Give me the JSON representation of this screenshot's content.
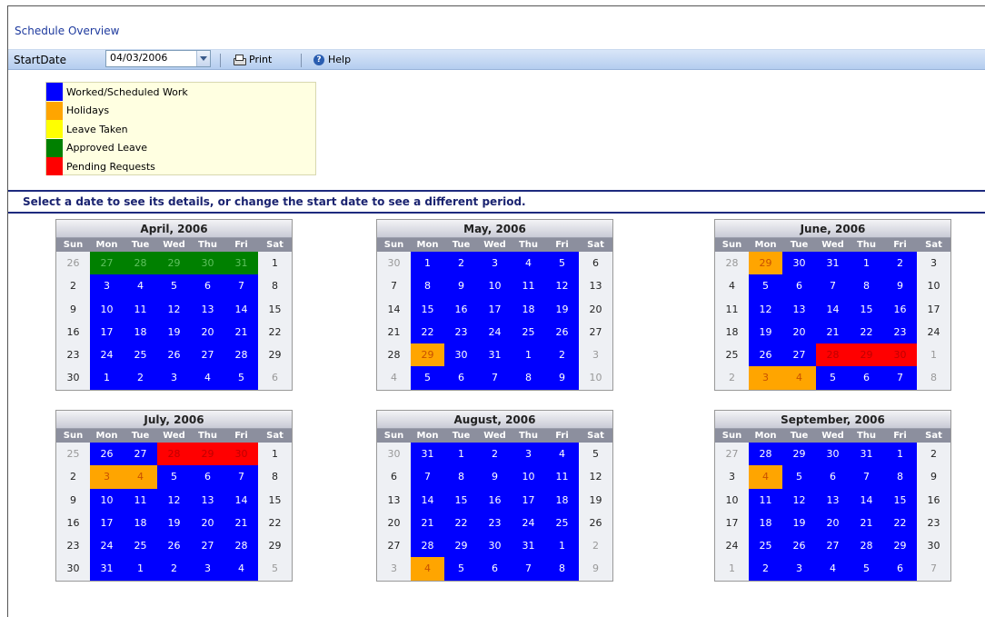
{
  "page_title": "Schedule Overview",
  "toolbar": {
    "start_date_label": "StartDate",
    "start_date_value": "04/03/2006",
    "print_label": "Print",
    "help_label": "Help"
  },
  "legend": [
    {
      "label": "Worked/Scheduled Work",
      "color": "#0000ff"
    },
    {
      "label": "Holidays",
      "color": "#ffa500"
    },
    {
      "label": "Leave Taken",
      "color": "#ffff00"
    },
    {
      "label": "Approved Leave",
      "color": "#008000"
    },
    {
      "label": "Pending Requests",
      "color": "#ff0000"
    }
  ],
  "instruction": "Select a date to see its details, or change the start date to see a different period.",
  "weekdays": [
    "Sun",
    "Mon",
    "Tue",
    "Wed",
    "Thu",
    "Fri",
    "Sat"
  ],
  "months": [
    {
      "title": "April, 2006",
      "weeks": [
        [
          [
            "26",
            "other"
          ],
          [
            "27",
            "green"
          ],
          [
            "28",
            "green"
          ],
          [
            "29",
            "green"
          ],
          [
            "30",
            "green"
          ],
          [
            "31",
            "green"
          ],
          [
            "1",
            "plain"
          ]
        ],
        [
          [
            "2",
            "plain"
          ],
          [
            "3",
            "blue"
          ],
          [
            "4",
            "blue"
          ],
          [
            "5",
            "blue"
          ],
          [
            "6",
            "blue"
          ],
          [
            "7",
            "blue"
          ],
          [
            "8",
            "plain"
          ]
        ],
        [
          [
            "9",
            "plain"
          ],
          [
            "10",
            "blue"
          ],
          [
            "11",
            "blue"
          ],
          [
            "12",
            "blue"
          ],
          [
            "13",
            "blue"
          ],
          [
            "14",
            "blue"
          ],
          [
            "15",
            "plain"
          ]
        ],
        [
          [
            "16",
            "plain"
          ],
          [
            "17",
            "blue"
          ],
          [
            "18",
            "blue"
          ],
          [
            "19",
            "blue"
          ],
          [
            "20",
            "blue"
          ],
          [
            "21",
            "blue"
          ],
          [
            "22",
            "plain"
          ]
        ],
        [
          [
            "23",
            "plain"
          ],
          [
            "24",
            "blue"
          ],
          [
            "25",
            "blue"
          ],
          [
            "26",
            "blue"
          ],
          [
            "27",
            "blue"
          ],
          [
            "28",
            "blue"
          ],
          [
            "29",
            "plain"
          ]
        ],
        [
          [
            "30",
            "plain"
          ],
          [
            "1",
            "blue"
          ],
          [
            "2",
            "blue"
          ],
          [
            "3",
            "blue"
          ],
          [
            "4",
            "blue"
          ],
          [
            "5",
            "blue"
          ],
          [
            "6",
            "other"
          ]
        ]
      ]
    },
    {
      "title": "May, 2006",
      "weeks": [
        [
          [
            "30",
            "other"
          ],
          [
            "1",
            "blue"
          ],
          [
            "2",
            "blue"
          ],
          [
            "3",
            "blue"
          ],
          [
            "4",
            "blue"
          ],
          [
            "5",
            "blue"
          ],
          [
            "6",
            "plain"
          ]
        ],
        [
          [
            "7",
            "plain"
          ],
          [
            "8",
            "blue"
          ],
          [
            "9",
            "blue"
          ],
          [
            "10",
            "blue"
          ],
          [
            "11",
            "blue"
          ],
          [
            "12",
            "blue"
          ],
          [
            "13",
            "plain"
          ]
        ],
        [
          [
            "14",
            "plain"
          ],
          [
            "15",
            "blue"
          ],
          [
            "16",
            "blue"
          ],
          [
            "17",
            "blue"
          ],
          [
            "18",
            "blue"
          ],
          [
            "19",
            "blue"
          ],
          [
            "20",
            "plain"
          ]
        ],
        [
          [
            "21",
            "plain"
          ],
          [
            "22",
            "blue"
          ],
          [
            "23",
            "blue"
          ],
          [
            "24",
            "blue"
          ],
          [
            "25",
            "blue"
          ],
          [
            "26",
            "blue"
          ],
          [
            "27",
            "plain"
          ]
        ],
        [
          [
            "28",
            "plain"
          ],
          [
            "29",
            "orange"
          ],
          [
            "30",
            "blue"
          ],
          [
            "31",
            "blue"
          ],
          [
            "1",
            "blue"
          ],
          [
            "2",
            "blue"
          ],
          [
            "3",
            "other"
          ]
        ],
        [
          [
            "4",
            "other"
          ],
          [
            "5",
            "blue"
          ],
          [
            "6",
            "blue"
          ],
          [
            "7",
            "blue"
          ],
          [
            "8",
            "blue"
          ],
          [
            "9",
            "blue"
          ],
          [
            "10",
            "other"
          ]
        ]
      ]
    },
    {
      "title": "June, 2006",
      "weeks": [
        [
          [
            "28",
            "other"
          ],
          [
            "29",
            "orange"
          ],
          [
            "30",
            "blue"
          ],
          [
            "31",
            "blue"
          ],
          [
            "1",
            "blue"
          ],
          [
            "2",
            "blue"
          ],
          [
            "3",
            "plain"
          ]
        ],
        [
          [
            "4",
            "plain"
          ],
          [
            "5",
            "blue"
          ],
          [
            "6",
            "blue"
          ],
          [
            "7",
            "blue"
          ],
          [
            "8",
            "blue"
          ],
          [
            "9",
            "blue"
          ],
          [
            "10",
            "plain"
          ]
        ],
        [
          [
            "11",
            "plain"
          ],
          [
            "12",
            "blue"
          ],
          [
            "13",
            "blue"
          ],
          [
            "14",
            "blue"
          ],
          [
            "15",
            "blue"
          ],
          [
            "16",
            "blue"
          ],
          [
            "17",
            "plain"
          ]
        ],
        [
          [
            "18",
            "plain"
          ],
          [
            "19",
            "blue"
          ],
          [
            "20",
            "blue"
          ],
          [
            "21",
            "blue"
          ],
          [
            "22",
            "blue"
          ],
          [
            "23",
            "blue"
          ],
          [
            "24",
            "plain"
          ]
        ],
        [
          [
            "25",
            "plain"
          ],
          [
            "26",
            "blue"
          ],
          [
            "27",
            "blue"
          ],
          [
            "28",
            "red"
          ],
          [
            "29",
            "red"
          ],
          [
            "30",
            "red"
          ],
          [
            "1",
            "other"
          ]
        ],
        [
          [
            "2",
            "other"
          ],
          [
            "3",
            "orange"
          ],
          [
            "4",
            "orange"
          ],
          [
            "5",
            "blue"
          ],
          [
            "6",
            "blue"
          ],
          [
            "7",
            "blue"
          ],
          [
            "8",
            "other"
          ]
        ]
      ]
    },
    {
      "title": "July, 2006",
      "weeks": [
        [
          [
            "25",
            "other"
          ],
          [
            "26",
            "blue"
          ],
          [
            "27",
            "blue"
          ],
          [
            "28",
            "red"
          ],
          [
            "29",
            "red"
          ],
          [
            "30",
            "red"
          ],
          [
            "1",
            "plain"
          ]
        ],
        [
          [
            "2",
            "plain"
          ],
          [
            "3",
            "orange"
          ],
          [
            "4",
            "orange"
          ],
          [
            "5",
            "blue"
          ],
          [
            "6",
            "blue"
          ],
          [
            "7",
            "blue"
          ],
          [
            "8",
            "plain"
          ]
        ],
        [
          [
            "9",
            "plain"
          ],
          [
            "10",
            "blue"
          ],
          [
            "11",
            "blue"
          ],
          [
            "12",
            "blue"
          ],
          [
            "13",
            "blue"
          ],
          [
            "14",
            "blue"
          ],
          [
            "15",
            "plain"
          ]
        ],
        [
          [
            "16",
            "plain"
          ],
          [
            "17",
            "blue"
          ],
          [
            "18",
            "blue"
          ],
          [
            "19",
            "blue"
          ],
          [
            "20",
            "blue"
          ],
          [
            "21",
            "blue"
          ],
          [
            "22",
            "plain"
          ]
        ],
        [
          [
            "23",
            "plain"
          ],
          [
            "24",
            "blue"
          ],
          [
            "25",
            "blue"
          ],
          [
            "26",
            "blue"
          ],
          [
            "27",
            "blue"
          ],
          [
            "28",
            "blue"
          ],
          [
            "29",
            "plain"
          ]
        ],
        [
          [
            "30",
            "plain"
          ],
          [
            "31",
            "blue"
          ],
          [
            "1",
            "blue"
          ],
          [
            "2",
            "blue"
          ],
          [
            "3",
            "blue"
          ],
          [
            "4",
            "blue"
          ],
          [
            "5",
            "other"
          ]
        ]
      ]
    },
    {
      "title": "August, 2006",
      "weeks": [
        [
          [
            "30",
            "other"
          ],
          [
            "31",
            "blue"
          ],
          [
            "1",
            "blue"
          ],
          [
            "2",
            "blue"
          ],
          [
            "3",
            "blue"
          ],
          [
            "4",
            "blue"
          ],
          [
            "5",
            "plain"
          ]
        ],
        [
          [
            "6",
            "plain"
          ],
          [
            "7",
            "blue"
          ],
          [
            "8",
            "blue"
          ],
          [
            "9",
            "blue"
          ],
          [
            "10",
            "blue"
          ],
          [
            "11",
            "blue"
          ],
          [
            "12",
            "plain"
          ]
        ],
        [
          [
            "13",
            "plain"
          ],
          [
            "14",
            "blue"
          ],
          [
            "15",
            "blue"
          ],
          [
            "16",
            "blue"
          ],
          [
            "17",
            "blue"
          ],
          [
            "18",
            "blue"
          ],
          [
            "19",
            "plain"
          ]
        ],
        [
          [
            "20",
            "plain"
          ],
          [
            "21",
            "blue"
          ],
          [
            "22",
            "blue"
          ],
          [
            "23",
            "blue"
          ],
          [
            "24",
            "blue"
          ],
          [
            "25",
            "blue"
          ],
          [
            "26",
            "plain"
          ]
        ],
        [
          [
            "27",
            "plain"
          ],
          [
            "28",
            "blue"
          ],
          [
            "29",
            "blue"
          ],
          [
            "30",
            "blue"
          ],
          [
            "31",
            "blue"
          ],
          [
            "1",
            "blue"
          ],
          [
            "2",
            "other"
          ]
        ],
        [
          [
            "3",
            "other"
          ],
          [
            "4",
            "orange"
          ],
          [
            "5",
            "blue"
          ],
          [
            "6",
            "blue"
          ],
          [
            "7",
            "blue"
          ],
          [
            "8",
            "blue"
          ],
          [
            "9",
            "other"
          ]
        ]
      ]
    },
    {
      "title": "September, 2006",
      "weeks": [
        [
          [
            "27",
            "other"
          ],
          [
            "28",
            "blue"
          ],
          [
            "29",
            "blue"
          ],
          [
            "30",
            "blue"
          ],
          [
            "31",
            "blue"
          ],
          [
            "1",
            "blue"
          ],
          [
            "2",
            "plain"
          ]
        ],
        [
          [
            "3",
            "plain"
          ],
          [
            "4",
            "orange"
          ],
          [
            "5",
            "blue"
          ],
          [
            "6",
            "blue"
          ],
          [
            "7",
            "blue"
          ],
          [
            "8",
            "blue"
          ],
          [
            "9",
            "plain"
          ]
        ],
        [
          [
            "10",
            "plain"
          ],
          [
            "11",
            "blue"
          ],
          [
            "12",
            "blue"
          ],
          [
            "13",
            "blue"
          ],
          [
            "14",
            "blue"
          ],
          [
            "15",
            "blue"
          ],
          [
            "16",
            "plain"
          ]
        ],
        [
          [
            "17",
            "plain"
          ],
          [
            "18",
            "blue"
          ],
          [
            "19",
            "blue"
          ],
          [
            "20",
            "blue"
          ],
          [
            "21",
            "blue"
          ],
          [
            "22",
            "blue"
          ],
          [
            "23",
            "plain"
          ]
        ],
        [
          [
            "24",
            "plain"
          ],
          [
            "25",
            "blue"
          ],
          [
            "26",
            "blue"
          ],
          [
            "27",
            "blue"
          ],
          [
            "28",
            "blue"
          ],
          [
            "29",
            "blue"
          ],
          [
            "30",
            "plain"
          ]
        ],
        [
          [
            "1",
            "other"
          ],
          [
            "2",
            "blue"
          ],
          [
            "3",
            "blue"
          ],
          [
            "4",
            "blue"
          ],
          [
            "5",
            "blue"
          ],
          [
            "6",
            "blue"
          ],
          [
            "7",
            "other"
          ]
        ]
      ]
    }
  ]
}
